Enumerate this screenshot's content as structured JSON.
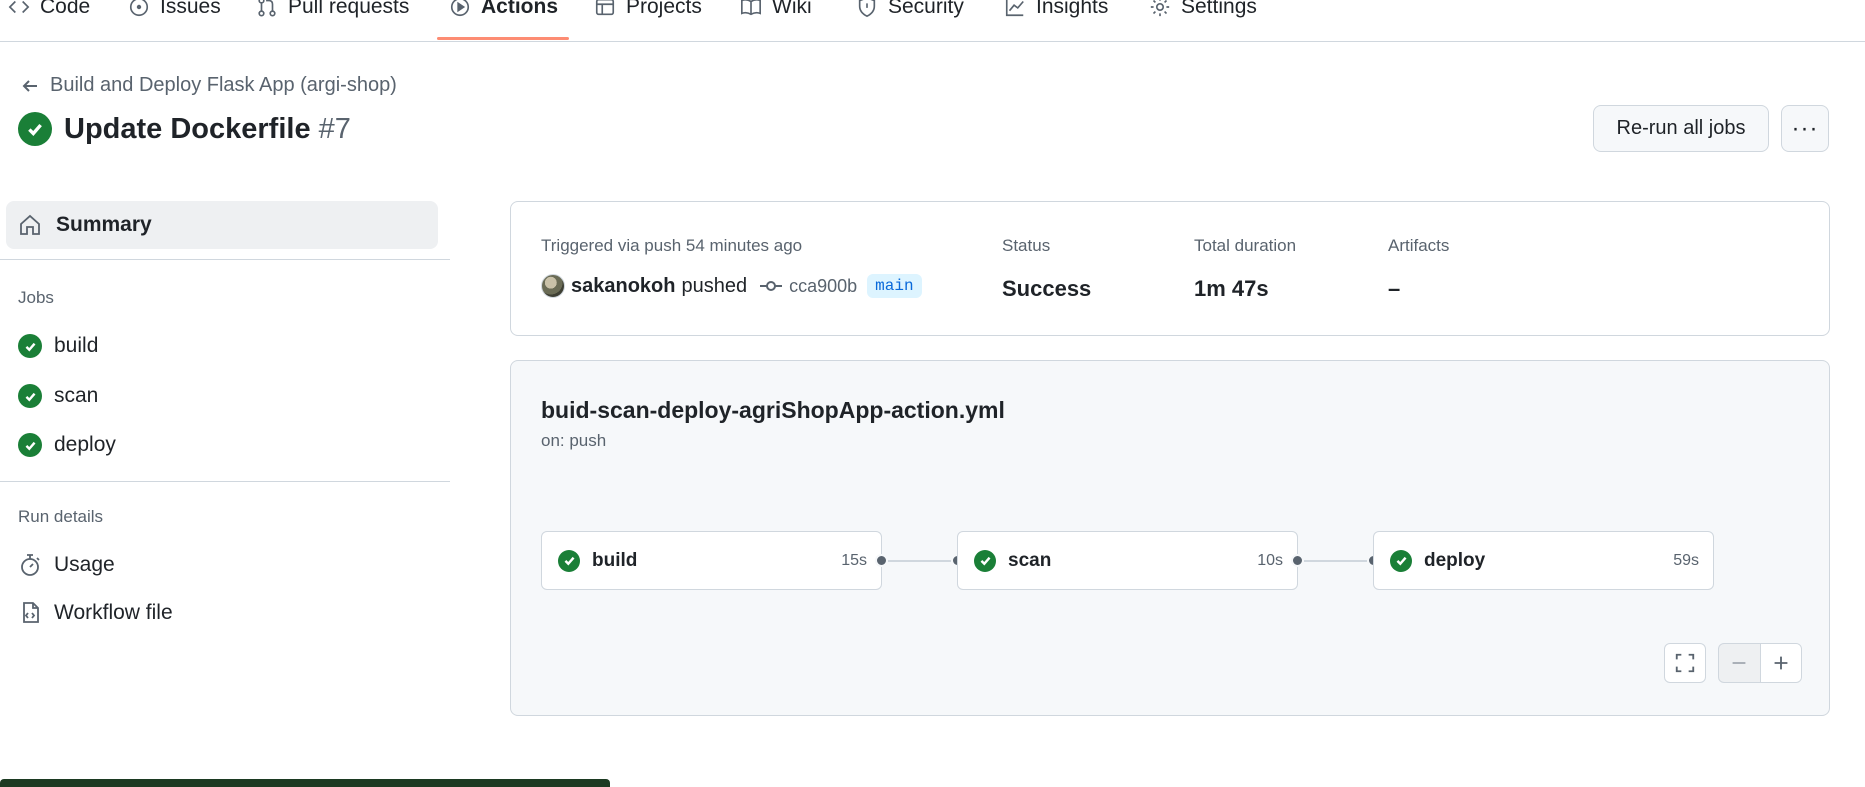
{
  "repo_nav": {
    "tabs": [
      {
        "label": "Code",
        "icon": "code-icon"
      },
      {
        "label": "Issues",
        "icon": "issue-icon"
      },
      {
        "label": "Pull requests",
        "icon": "pull-request-icon"
      },
      {
        "label": "Actions",
        "icon": "play-icon",
        "active": true
      },
      {
        "label": "Projects",
        "icon": "table-icon"
      },
      {
        "label": "Wiki",
        "icon": "book-icon"
      },
      {
        "label": "Security",
        "icon": "shield-icon"
      },
      {
        "label": "Insights",
        "icon": "graph-icon"
      },
      {
        "label": "Settings",
        "icon": "gear-icon"
      }
    ]
  },
  "header": {
    "back_label": "Build and Deploy Flask App (argi-shop)",
    "run_title": "Update Dockerfile",
    "run_number": "#7",
    "rerun_label": "Re-run all jobs",
    "more_label": "···"
  },
  "sidebar": {
    "summary_label": "Summary",
    "jobs_heading": "Jobs",
    "jobs": [
      {
        "label": "build",
        "status": "success"
      },
      {
        "label": "scan",
        "status": "success"
      },
      {
        "label": "deploy",
        "status": "success"
      }
    ],
    "run_details_heading": "Run details",
    "details": [
      {
        "label": "Usage",
        "icon": "stopwatch-icon"
      },
      {
        "label": "Workflow file",
        "icon": "file-code-icon"
      }
    ]
  },
  "summary": {
    "triggered_text": "Triggered via push 54 minutes ago",
    "user": "sakanokoh",
    "verb": "pushed",
    "commit_sha": "cca900b",
    "branch": "main",
    "status_label": "Status",
    "status_value": "Success",
    "duration_label": "Total duration",
    "duration_value": "1m 47s",
    "artifacts_label": "Artifacts",
    "artifacts_value": "–"
  },
  "workflow": {
    "file_name": "buid-scan-deploy-agriShopApp-action.yml",
    "trigger": "on: push",
    "jobs": [
      {
        "name": "build",
        "duration": "15s"
      },
      {
        "name": "scan",
        "duration": "10s"
      },
      {
        "name": "deploy",
        "duration": "59s"
      }
    ]
  },
  "colors": {
    "success": "#1a7f37",
    "accent_underline": "#fd8c73",
    "branch_bg": "#ddf4ff",
    "branch_fg": "#0969da"
  }
}
